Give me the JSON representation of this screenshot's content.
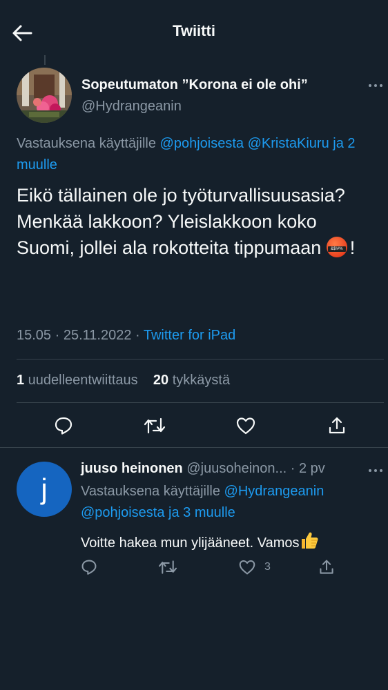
{
  "header": {
    "title": "Twiitti"
  },
  "tweet": {
    "author_name": "Sopeutumaton ”Korona ei ole ohi”",
    "author_handle": "@Hydrangeanin",
    "reply_prefix": "Vastauksena käyttäjille ",
    "reply_mention1": "@pohjoisesta",
    "reply_mention2": "@KristaKiuru",
    "reply_others": "ja 2 muulle",
    "text": "Eikö tällainen ole jo työturvallisuusasia? Menkää lakkoon? Yleislakkoon koko Suomi, jollei ala rokotteita tippumaan ",
    "text_end": "!",
    "time_date": "15.05 · 25.11.2022 · ",
    "source": "Twitter for iPad",
    "retweet_count": "1",
    "retweet_label": " uudelleentwiittaus",
    "like_count": "20",
    "like_label": " tykkäystä"
  },
  "reply": {
    "avatar_letter": "j",
    "name": "juuso heinonen",
    "handle": "@juusoheinon...",
    "time": "· 2 pv",
    "reply_prefix": "Vastauksena käyttäjille ",
    "reply_mention1": "@Hydrangeanin",
    "reply_mention2": "@pohjoisesta ja 3 muulle",
    "text": "Voitte hakea mun ylijääneet. Vamos",
    "like_count": "3"
  },
  "icons": {
    "accent": "#1d9bf0",
    "secondary_text": "#8b98a5",
    "background": "#15202b"
  }
}
